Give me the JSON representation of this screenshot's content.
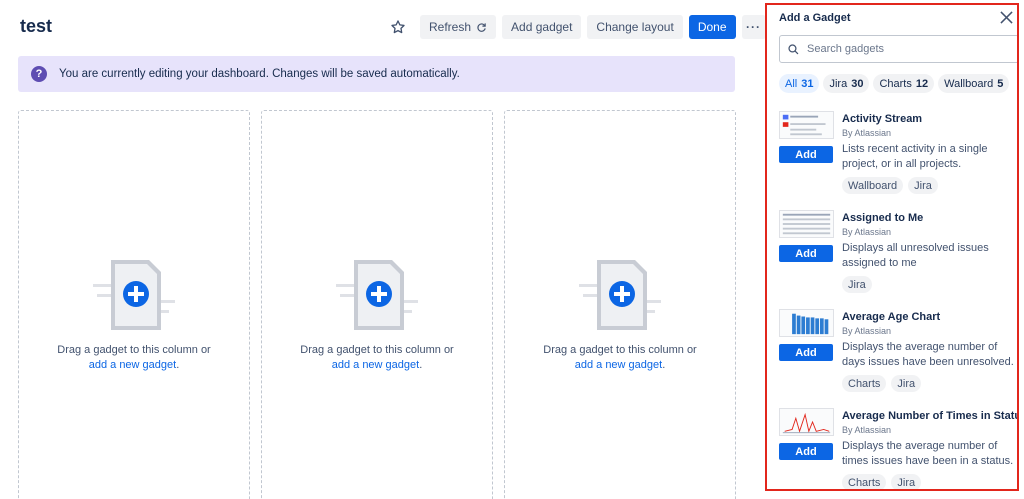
{
  "header": {
    "title": "test",
    "buttons": {
      "refresh": "Refresh",
      "add_gadget": "Add gadget",
      "change_layout": "Change layout",
      "done": "Done",
      "more": "···"
    }
  },
  "banner": {
    "icon": "?",
    "text": "You are currently editing your dashboard. Changes will be saved automatically."
  },
  "columns": [
    {
      "text": "Drag a gadget to this column or",
      "link": "add a new gadget",
      "suffix": "."
    },
    {
      "text": "Drag a gadget to this column or",
      "link": "add a new gadget",
      "suffix": "."
    },
    {
      "text": "Drag a gadget to this column or",
      "link": "add a new gadget",
      "suffix": "."
    }
  ],
  "panel": {
    "title": "Add a Gadget",
    "search_placeholder": "Search gadgets",
    "filters": [
      {
        "label": "All",
        "count": "31"
      },
      {
        "label": "Jira",
        "count": "30"
      },
      {
        "label": "Charts",
        "count": "12"
      },
      {
        "label": "Wallboard",
        "count": "5"
      }
    ],
    "add_label": "Add",
    "gadgets": [
      {
        "name": "Activity Stream",
        "by": "By Atlassian",
        "desc": "Lists recent activity in a single project, or in all projects.",
        "tags": [
          "Wallboard",
          "Jira"
        ]
      },
      {
        "name": "Assigned to Me",
        "by": "By Atlassian",
        "desc": "Displays all unresolved issues assigned to me",
        "tags": [
          "Jira"
        ]
      },
      {
        "name": "Average Age Chart",
        "by": "By Atlassian",
        "desc": "Displays the average number of days issues have been unresolved.",
        "tags": [
          "Charts",
          "Jira"
        ]
      },
      {
        "name": "Average Number of Times in Status",
        "by": "By Atlassian",
        "desc": "Displays the average number of times issues have been in a status.",
        "tags": [
          "Charts",
          "Jira"
        ]
      }
    ]
  },
  "colors": {
    "primary": "#0c66e4",
    "banner_bg": "#e7e3fb",
    "panel_border": "#e2261c"
  }
}
